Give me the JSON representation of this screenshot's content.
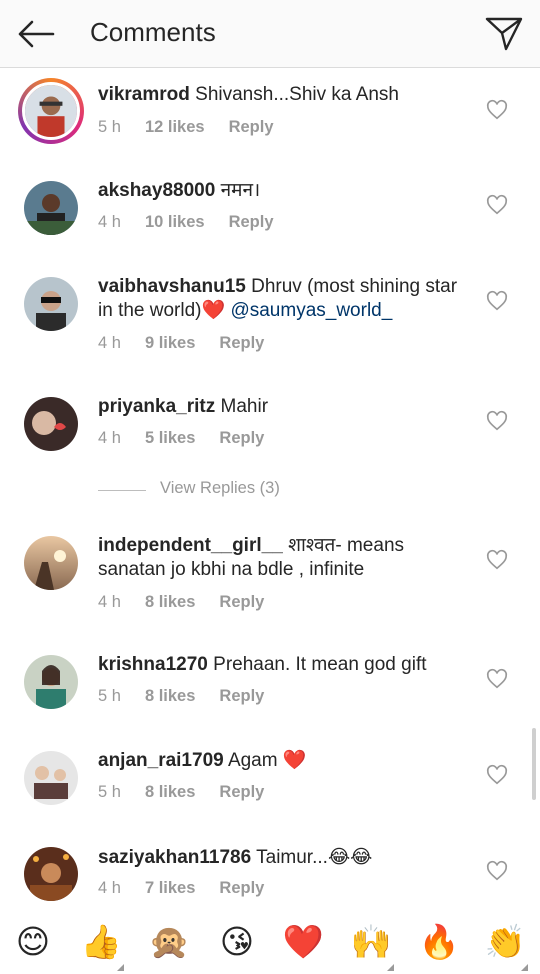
{
  "header": {
    "title": "Comments"
  },
  "comments": [
    {
      "username": "vikramrod",
      "text": "Shivansh...Shiv ka Ansh",
      "mention": "",
      "emoji": "",
      "time": "5 h",
      "likes": "12 likes",
      "reply": "Reply",
      "story": true
    },
    {
      "username": "akshay88000",
      "text": "नमन।",
      "mention": "",
      "emoji": "",
      "time": "4 h",
      "likes": "10 likes",
      "reply": "Reply",
      "story": false
    },
    {
      "username": "vaibhavshanu15",
      "text": "Dhruv (most shining star in the world)",
      "mention": "@saumyas_world_",
      "emoji": "❤️",
      "time": "4 h",
      "likes": "9 likes",
      "reply": "Reply",
      "story": false
    },
    {
      "username": "priyanka_ritz",
      "text": "Mahir",
      "mention": "",
      "emoji": "",
      "time": "4 h",
      "likes": "5 likes",
      "reply": "Reply",
      "story": false
    },
    {
      "username": "independent__girl__",
      "text": "शाश्वत- means sanatan jo kbhi na bdle , infinite",
      "mention": "",
      "emoji": "",
      "time": "4 h",
      "likes": "8 likes",
      "reply": "Reply",
      "story": false
    },
    {
      "username": "krishna1270",
      "text": "Prehaan. It mean god gift",
      "mention": "",
      "emoji": "",
      "time": "5 h",
      "likes": "8 likes",
      "reply": "Reply",
      "story": false
    },
    {
      "username": "anjan_rai1709",
      "text": "Agam",
      "mention": "",
      "emoji": "❤️",
      "time": "5 h",
      "likes": "8 likes",
      "reply": "Reply",
      "story": false
    },
    {
      "username": "saziyakhan11786",
      "text": "Taimur...",
      "mention": "",
      "emoji": "😂😂",
      "time": "4 h",
      "likes": "7 likes",
      "reply": "Reply",
      "story": false
    }
  ],
  "view_replies": "View Replies (3)",
  "quick_emojis": [
    "😊",
    "👍",
    "🙊",
    "😘",
    "❤️",
    "🙌",
    "🔥",
    "👏"
  ],
  "colors": {
    "mention": "#003569",
    "meta": "#999999",
    "text": "#262626",
    "heart_emoji": "#e0252d"
  }
}
